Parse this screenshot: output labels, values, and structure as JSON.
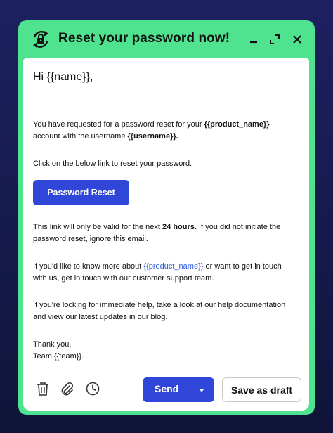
{
  "window": {
    "title": "Reset your password now!",
    "icons": {
      "title": "lock-reset-icon",
      "minimize": "minimize-icon",
      "expand": "expand-icon",
      "close": "close-icon"
    }
  },
  "email": {
    "greeting": "Hi {{name}},",
    "p1": {
      "pre": "You have requested for a password reset for your ",
      "product": "{{product_name}}",
      "mid": " account with the username ",
      "username": "{{username}}."
    },
    "p2": "Click on the below link to reset your password.",
    "reset_button": "Password Reset",
    "p3": {
      "pre": "This link will only be valid for the next ",
      "bold": "24 hours.",
      "post": " If you did not initiate the password reset, ignore this email."
    },
    "p4": {
      "pre": "If you'd like to know more about ",
      "link": "{{product_name}}",
      "post": " or want to get in touch with us, get in touch with our customer support team."
    },
    "p5": "If you're locking for immediate help, take a look at our help documentation and view our latest updates in our blog.",
    "signoff_1": "Thank you,",
    "signoff_2": "Team {{team}}."
  },
  "footer": {
    "send_label": "Send",
    "draft_label": "Save as draft",
    "icons": [
      "trash-icon",
      "paperclip-icon",
      "clock-icon",
      "caret-down-icon"
    ]
  },
  "colors": {
    "frame": "#4fe38f",
    "primary": "#2f46d8",
    "link": "#2f5bd8",
    "background": "#1d2160"
  }
}
